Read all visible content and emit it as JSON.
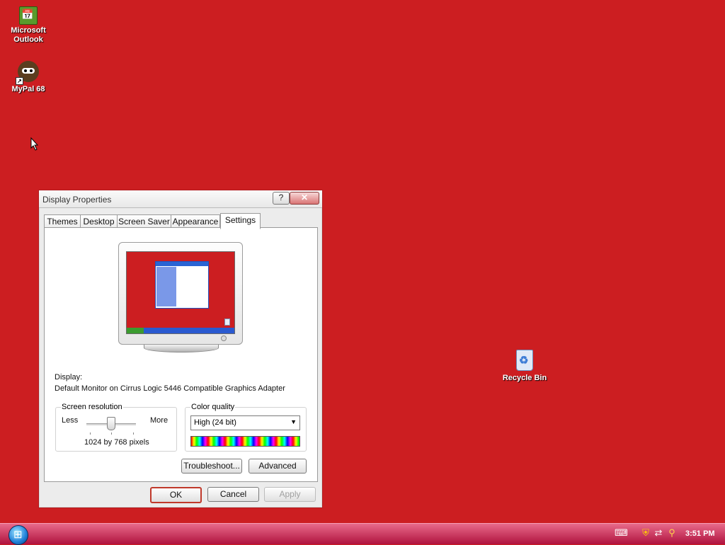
{
  "desktop": {
    "icons": [
      {
        "label_line1": "Microsoft",
        "label_line2": "Outlook",
        "icon": "outlook-icon"
      },
      {
        "label": "MyPal 68",
        "icon": "mypal-icon"
      },
      {
        "label": "Recycle Bin",
        "icon": "recycle-bin-icon"
      }
    ],
    "background_color": "#cc1e21"
  },
  "dialog": {
    "title": "Display Properties",
    "help_button": "?",
    "close_button": "✕",
    "tabs": [
      "Themes",
      "Desktop",
      "Screen Saver",
      "Appearance",
      "Settings"
    ],
    "active_tab": "Settings",
    "display_label": "Display:",
    "display_value": "Default Monitor on Cirrus Logic 5446 Compatible Graphics Adapter",
    "screen_resolution": {
      "label": "Screen resolution",
      "less_label": "Less",
      "more_label": "More",
      "value_text": "1024 by 768 pixels"
    },
    "color_quality": {
      "label": "Color quality",
      "selected": "High (24 bit)"
    },
    "troubleshoot_button": "Troubleshoot...",
    "advanced_button": "Advanced",
    "ok_button": "OK",
    "cancel_button": "Cancel",
    "apply_button": "Apply"
  },
  "taskbar": {
    "start": "start-orb-icon",
    "clock": "3:51 PM",
    "tray_icons": [
      "keyboard-icon",
      "security-shield-icon",
      "network-icon",
      "search-icon"
    ]
  }
}
